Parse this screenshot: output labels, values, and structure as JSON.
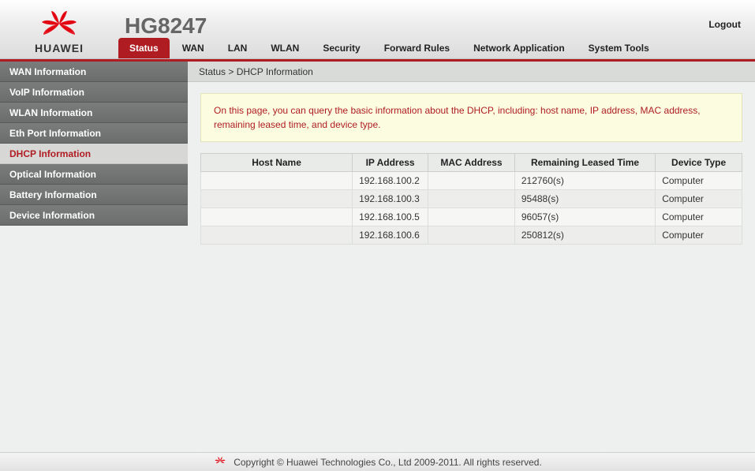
{
  "brand": "HUAWEI",
  "model": "HG8247",
  "logout": "Logout",
  "nav": {
    "items": [
      "Status",
      "WAN",
      "LAN",
      "WLAN",
      "Security",
      "Forward Rules",
      "Network Application",
      "System Tools"
    ],
    "active_index": 0
  },
  "sidebar": {
    "items": [
      "WAN Information",
      "VoIP Information",
      "WLAN Information",
      "Eth Port Information",
      "DHCP Information",
      "Optical Information",
      "Battery Information",
      "Device Information"
    ],
    "selected_index": 4
  },
  "breadcrumb": "Status > DHCP Information",
  "notice": "On this page, you can query the basic information about the DHCP, including: host name, IP address, MAC address, remaining leased time, and device type.",
  "table": {
    "headers": [
      "Host Name",
      "IP Address",
      "MAC Address",
      "Remaining Leased Time",
      "Device Type"
    ],
    "rows": [
      {
        "host": "",
        "ip": "192.168.100.2",
        "mac": "",
        "leased": "212760(s)",
        "type": "Computer"
      },
      {
        "host": "",
        "ip": "192.168.100.3",
        "mac": "",
        "leased": "95488(s)",
        "type": "Computer"
      },
      {
        "host": "",
        "ip": "192.168.100.5",
        "mac": "",
        "leased": "96057(s)",
        "type": "Computer"
      },
      {
        "host": "",
        "ip": "192.168.100.6",
        "mac": "",
        "leased": "250812(s)",
        "type": "Computer"
      }
    ]
  },
  "footer": "Copyright © Huawei Technologies Co., Ltd 2009-2011. All rights reserved."
}
